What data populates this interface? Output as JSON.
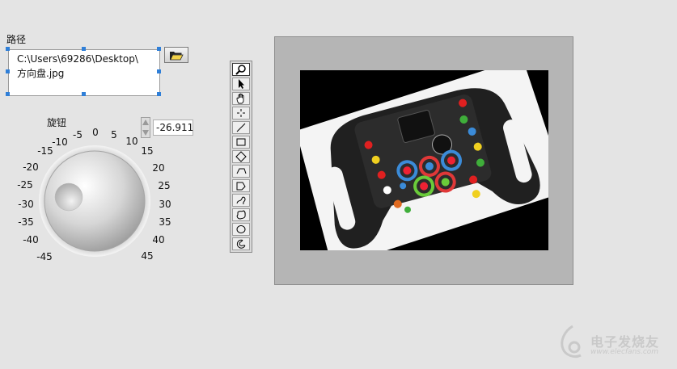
{
  "path_control": {
    "label": "路径",
    "value_line1": "C:\\Users\\69286\\Desktop\\",
    "value_line2": "方向盘.jpg"
  },
  "knob": {
    "label": "旋钮",
    "value": "-26.911",
    "scale": [
      "-45",
      "-40",
      "-35",
      "-30",
      "-25",
      "-20",
      "-15",
      "-10",
      "-5",
      "0",
      "5",
      "10",
      "15",
      "20",
      "25",
      "30",
      "35",
      "40",
      "45"
    ]
  },
  "tools_palette": {
    "tools": [
      "zoom-tool",
      "pointer-tool",
      "pan-tool",
      "point-tool",
      "line-tool",
      "rectangle-tool",
      "rotated-rectangle-tool",
      "polyline-tool",
      "polygon-tool",
      "freehand-line-tool",
      "freehand-region-tool",
      "oval-tool",
      "annulus-tool"
    ],
    "active": "zoom-tool"
  },
  "image_display": {
    "content": "steering-wheel-image"
  },
  "watermark": {
    "name": "电子发烧友",
    "url": "www.elecfans.com"
  }
}
